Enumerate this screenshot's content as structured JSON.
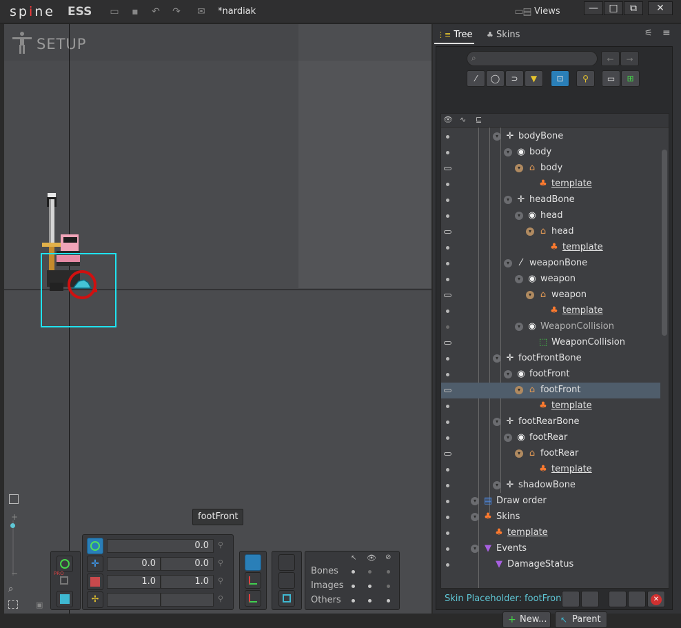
{
  "titlebar": {
    "logo": "spine",
    "edition": "ESS",
    "document_title": "*nardiak",
    "views_label": "Views"
  },
  "viewport": {
    "mode_label": "SETUP",
    "tooltip": "footFront",
    "transform": {
      "rotate": "0.0",
      "translate_x": "0.0",
      "translate_y": "0.0",
      "scale_x": "1.0",
      "scale_y": "1.0"
    },
    "visibility": {
      "rows": [
        "Bones",
        "Images",
        "Others"
      ]
    },
    "pro_badge": "PRO"
  },
  "panel": {
    "tabs": [
      "Tree",
      "Skins"
    ],
    "tree_rows": [
      {
        "label": "bodyBone",
        "icon": "bone-icon",
        "indent": 3
      },
      {
        "label": "body",
        "icon": "slot-icon",
        "indent": 4
      },
      {
        "label": "body",
        "icon": "skin-placeholder-icon",
        "indent": 5
      },
      {
        "label": "template",
        "icon": "skin-icon",
        "indent": 6,
        "link": true
      },
      {
        "label": "headBone",
        "icon": "bone-icon",
        "indent": 4
      },
      {
        "label": "head",
        "icon": "slot-icon",
        "indent": 5
      },
      {
        "label": "head",
        "icon": "skin-placeholder-icon",
        "indent": 6
      },
      {
        "label": "template",
        "icon": "skin-icon",
        "indent": 7,
        "link": true
      },
      {
        "label": "weaponBone",
        "icon": "bone-weapon-icon",
        "indent": 4
      },
      {
        "label": "weapon",
        "icon": "slot-icon",
        "indent": 5
      },
      {
        "label": "weapon",
        "icon": "skin-placeholder-icon",
        "indent": 6
      },
      {
        "label": "template",
        "icon": "skin-icon",
        "indent": 7,
        "link": true
      },
      {
        "label": "WeaponCollision",
        "icon": "slot-icon",
        "indent": 5,
        "dim": true
      },
      {
        "label": "WeaponCollision",
        "icon": "bounding-box-icon",
        "indent": 6
      },
      {
        "label": "footFrontBone",
        "icon": "bone-icon",
        "indent": 3
      },
      {
        "label": "footFront",
        "icon": "slot-icon",
        "indent": 4
      },
      {
        "label": "footFront",
        "icon": "skin-placeholder-icon",
        "indent": 5,
        "selected": true
      },
      {
        "label": "template",
        "icon": "skin-icon",
        "indent": 6,
        "link": true
      },
      {
        "label": "footRearBone",
        "icon": "bone-icon",
        "indent": 3
      },
      {
        "label": "footRear",
        "icon": "slot-icon",
        "indent": 4
      },
      {
        "label": "footRear",
        "icon": "skin-placeholder-icon",
        "indent": 5
      },
      {
        "label": "template",
        "icon": "skin-icon",
        "indent": 6,
        "link": true
      },
      {
        "label": "shadowBone",
        "icon": "bone-icon",
        "indent": 3
      },
      {
        "label": "Draw order",
        "icon": "draw-order-icon",
        "indent": 1
      },
      {
        "label": "Skins",
        "icon": "skins-icon",
        "indent": 1
      },
      {
        "label": "template",
        "icon": "skin-icon",
        "indent": 2,
        "link": true
      },
      {
        "label": "Events",
        "icon": "events-icon",
        "indent": 1
      },
      {
        "label": "DamageStatus",
        "icon": "event-icon",
        "indent": 2
      }
    ],
    "status_text": "Skin Placeholder: footFront",
    "new_button": "New...",
    "parent_button": "Parent"
  },
  "colors": {
    "accent_blue": "#2a7fb8",
    "status_cyan": "#5fc7d6",
    "selection": "#4f5d6b",
    "skin_orange": "#ff7a2e",
    "placeholder_orange": "#e39a55"
  }
}
